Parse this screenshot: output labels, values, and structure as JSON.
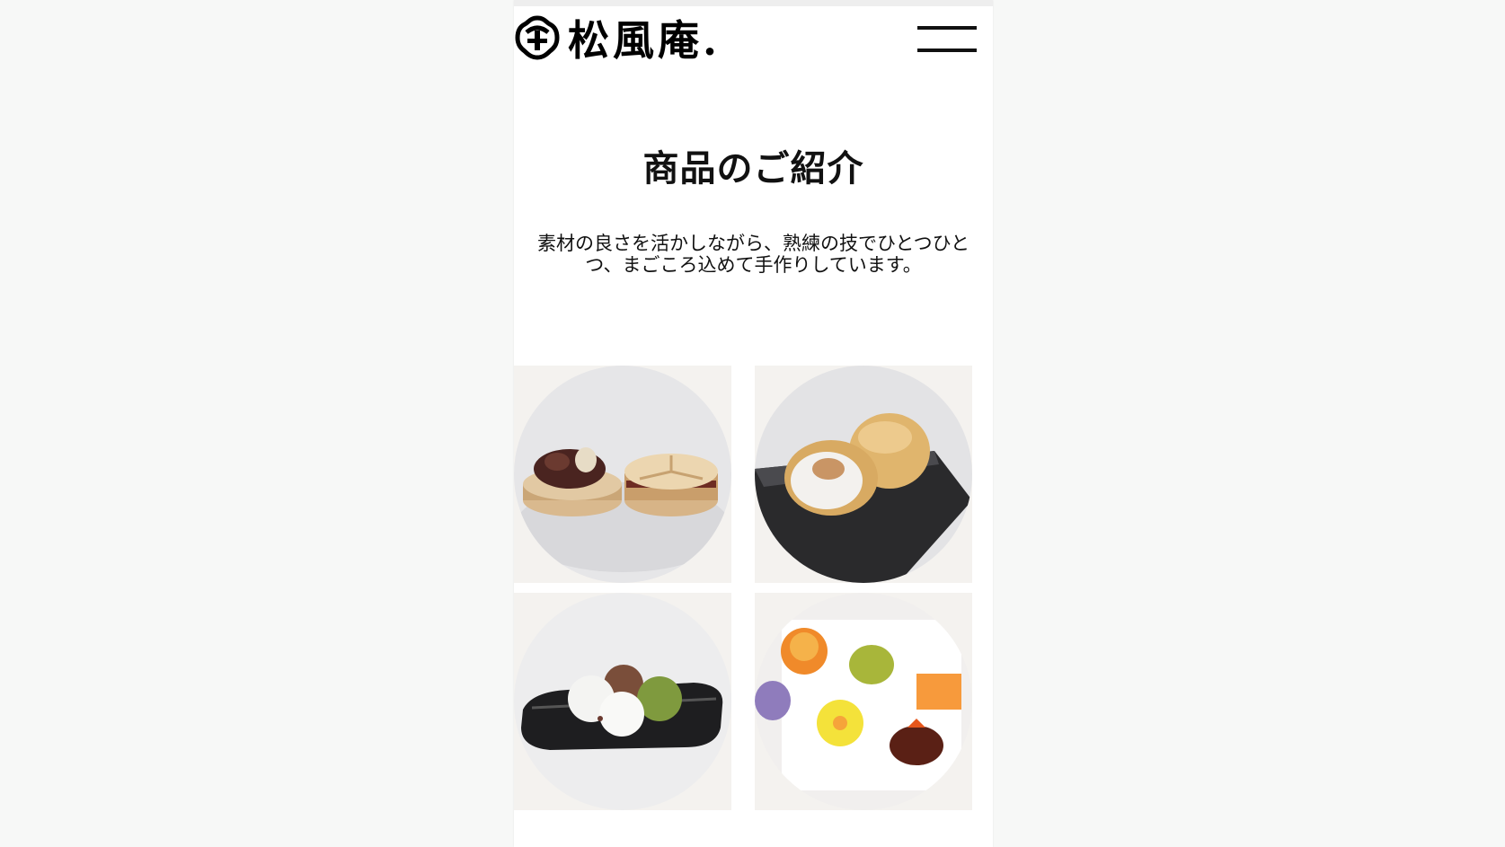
{
  "header": {
    "logo_text": "松風庵.",
    "menu_icon": "hamburger-menu-icon"
  },
  "main": {
    "title": "商品のご紹介",
    "description": "素材の良さを活かしながら、熟練の技でひとつひとつ、まごころ込めて手作りしています。"
  },
  "products": [
    {
      "name": "monaka-product-image"
    },
    {
      "name": "manju-product-image"
    },
    {
      "name": "daifuku-product-image"
    },
    {
      "name": "namagashi-product-image"
    }
  ]
}
